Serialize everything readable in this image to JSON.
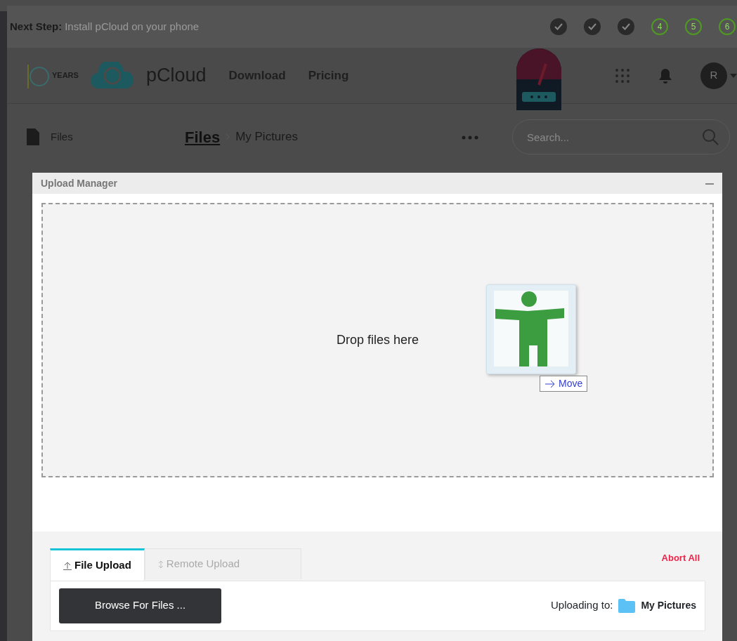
{
  "setup_bar": {
    "label": "Next Step:",
    "text": "Install pCloud on your phone",
    "steps": [
      {
        "done": true
      },
      {
        "done": true
      },
      {
        "done": true
      },
      {
        "label": "4",
        "done": false
      },
      {
        "label": "5",
        "done": false
      },
      {
        "label": "6",
        "done": false
      }
    ]
  },
  "header": {
    "badge": "YEARS",
    "brand": "pCloud",
    "nav": [
      "Download",
      "Pricing"
    ],
    "avatar": "R"
  },
  "sidebar": {
    "items": [
      "Files"
    ]
  },
  "breadcrumb": [
    "Files",
    "My Pictures"
  ],
  "search": {
    "placeholder": "Search..."
  },
  "upload_manager": {
    "title": "Upload Manager",
    "drop_text": "Drop files here",
    "drag_label": "Move",
    "tabs": [
      {
        "label": "File Upload",
        "selected": true
      },
      {
        "label": "Remote Upload",
        "selected": false
      }
    ],
    "abort": "Abort All",
    "browse": "Browse For Files ...",
    "destination_label": "Uploading to:",
    "destination": "My Pictures"
  }
}
